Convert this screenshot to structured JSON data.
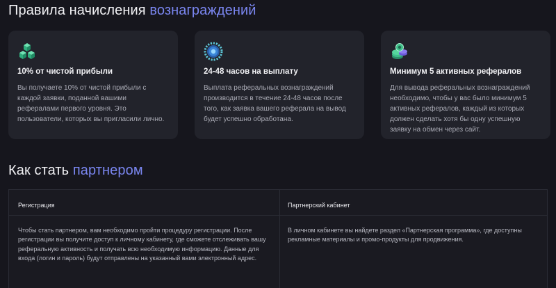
{
  "rewards": {
    "title_main": "Правила начисления ",
    "title_accent": "вознаграждений",
    "cards": [
      {
        "icon": "cubes-icon",
        "title": "10% от чистой прибыли",
        "text": "Вы получаете 10% от чистой прибыли с каждой заявки, поданной вашими рефералами первого уровня. Это пользователи, которых вы пригласили лично."
      },
      {
        "icon": "gear-coin-icon",
        "title": "24-48 часов на выплату",
        "text": "Выплата реферальных вознаграждений производится в течение 24-48 часов после того, как заявка вашего реферала на вывод будет успешно обработана."
      },
      {
        "icon": "coins-stack-icon",
        "title": "Минимум 5 активных рефералов",
        "text": "Для вывода реферальных вознаграждений необходимо, чтобы у вас было минимум 5 активных рефералов, каждый из которых должен сделать хотя бы одну успешную заявку на обмен через сайт."
      }
    ]
  },
  "partner": {
    "title_main": "Как стать ",
    "title_accent": "партнером",
    "columns": [
      {
        "header": "Регистрация",
        "text": "Чтобы стать партнером, вам необходимо пройти процедуру регистрации. После регистрации вы получите доступ к личному кабинету, где сможете отслеживать вашу реферальную активность и получать всю необходимую информацию. Данные для входа (логин и пароль) будут отправлены на указанный вами электронный адрес."
      },
      {
        "header": "Партнерский кабинет",
        "text": "В личном кабинете вы найдете раздел «Партнерская программа», где доступны рекламные материалы и промо-продукты для продвижения."
      }
    ]
  },
  "colors": {
    "background": "#16161d",
    "card": "#22232b",
    "accent": "#7a86f0"
  }
}
